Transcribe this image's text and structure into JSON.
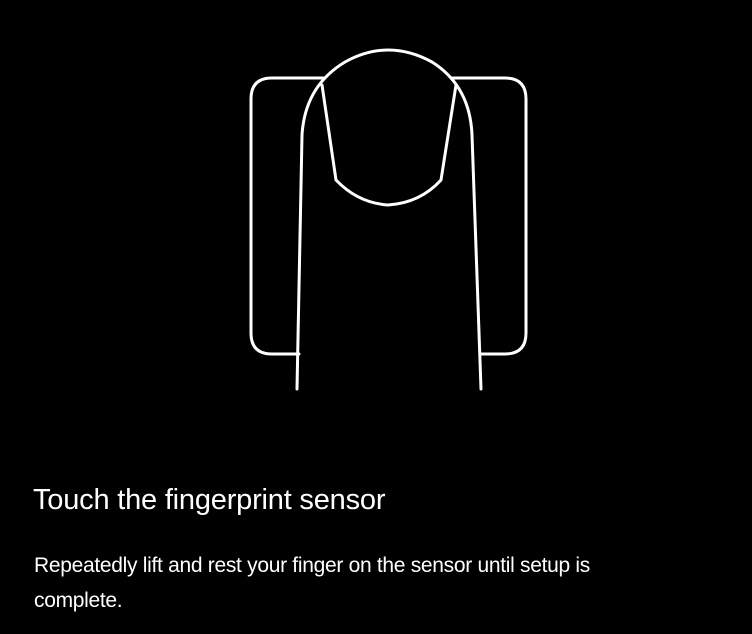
{
  "colors": {
    "background": "#000000",
    "foreground": "#ffffff"
  },
  "illustration": {
    "icon": "finger-on-sensor-icon"
  },
  "content": {
    "title": "Touch the fingerprint sensor",
    "body": "Repeatedly lift and rest your finger on the sensor until setup is complete."
  }
}
